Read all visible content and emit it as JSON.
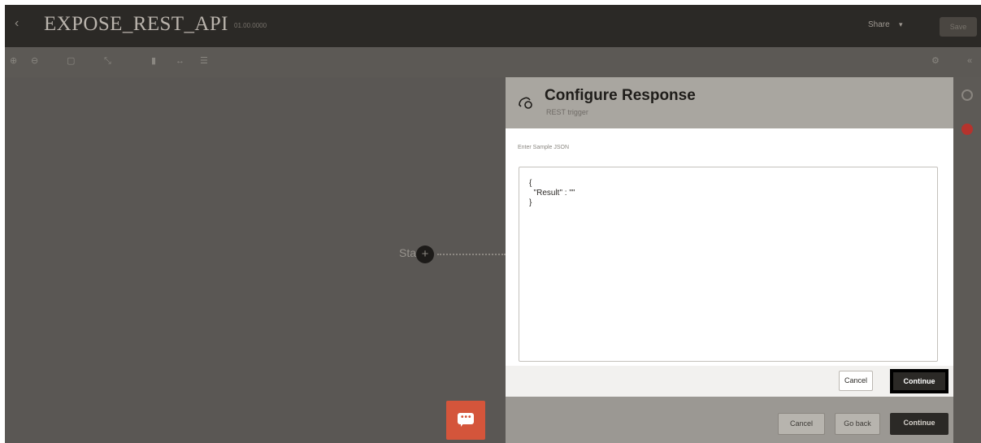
{
  "app": {
    "back_glyph": "‹",
    "integration_name": "EXPOSE_REST_API",
    "version": "01.00.0000",
    "share_label": "Share",
    "share_caret": "▾",
    "save_label": "Save"
  },
  "toolbar": {
    "icons": [
      "zoom-in-icon",
      "zoom-out-icon",
      "fit-icon",
      "expand-icon",
      "vertical-layout-icon",
      "horizontal-layout-icon",
      "pseudo-view-icon"
    ],
    "glyphs": [
      "⊕",
      "⊖",
      "▢",
      "⤡",
      "▮",
      "↔",
      "☰"
    ],
    "settings_glyph": "⚙",
    "collapse_glyph": "«"
  },
  "canvas": {
    "start_label": "Start",
    "start_node_glyph": "+",
    "chat_dots": "•••",
    "chat_color": "#d4553b"
  },
  "dialog": {
    "title": "Configure Response",
    "subtitle": "REST trigger",
    "json_label": "Enter Sample JSON",
    "json_value": "{\n  \"Result\" : \"\"\n}",
    "cancel_label": "Cancel",
    "continue_label": "Continue"
  },
  "wizard_footer": {
    "cancel_label": "Cancel",
    "go_back_label": "Go back",
    "continue_label": "Continue"
  },
  "rail": {
    "icons": [
      "history-icon",
      "activity-icon"
    ],
    "colors": [
      "#5d5a56",
      "#b5332d"
    ]
  }
}
